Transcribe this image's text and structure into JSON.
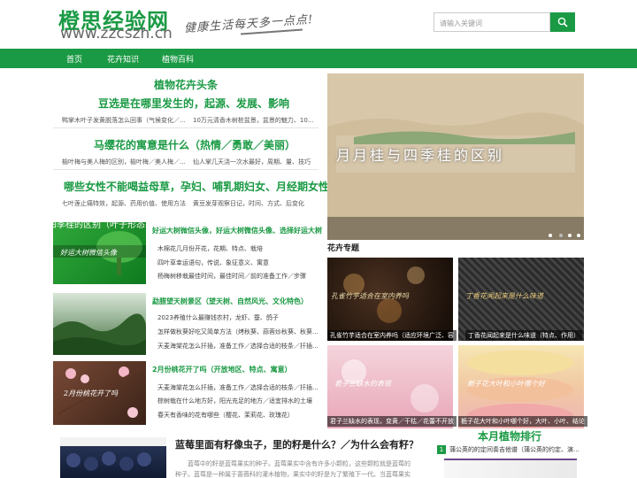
{
  "header": {
    "logo_title": "橙思经验网",
    "logo_url": "www.zzcszh.cn",
    "slogan": "健康生活每天多一点点!",
    "search_placeholder": "请输入关键词"
  },
  "nav": {
    "items": [
      "首页",
      "花卉知识",
      "植物百科"
    ]
  },
  "left": {
    "section_title": "植物花卉头条",
    "headlines": [
      {
        "title": "豆选是在哪里发生的，起源、发展、影响",
        "links": [
          "鸭掌木叶子发黄脱落怎么回事（气候变化／...",
          "10万元清香木树桩盆景，盆景的魅力、10..."
        ]
      },
      {
        "title": "马缨花的寓意是什么（热情／勇敢／美丽）",
        "links": [
          "榆叶梅与美人梅的区别，榆叶梅／美人梅／...",
          "仙人掌几天浇一次水最好，周期、量、技巧"
        ]
      },
      {
        "title": "哪些女性不能喝益母草，孕妇、哺乳期妇女、月经期女性",
        "links": [
          "七叶莲止痛特效，起源、药用价值、使用方法",
          "黄豆发芽观察日记，时间、方式、后变化"
        ]
      }
    ],
    "cards": [
      {
        "img_caption": "好运大树微信头像",
        "title": "好运大树微信头像，好运大树微信头像、选择好运大树",
        "lines": [
          "木棉花几月份开花，花期、特点、栽培",
          "四叶草幸运语句，传说、象征意义、寓意",
          "杨梅树移栽最佳时间，最佳时间／前的准备工作／步骤"
        ]
      },
      {
        "img_caption": "",
        "title": "勐腊望天树景区（望天树、自然风光、文化特色）",
        "lines": [
          "2023养殖什么最赚钱农村，龙虾、蚕、鸽子",
          "怎样做秋葵好吃又简单方法（烤秋葵、蒜蓉炒秋葵、秋葵...",
          "天麦海棠花怎么扦插，准备工作／选择合适的枝条／扦插..."
        ]
      },
      {
        "img_caption": "2月份桃花开了吗",
        "title": "2月份桃花开了吗（开放地区、特点、寓意）",
        "lines": [
          "天麦海棠花怎么扦插，准备工作／选择合适的枝条／扦插...",
          "棕树栽在什么地方好，阳光充足的地方／适宜排水的土壤",
          "春天有香味的花有哪些（樱花、茉莉花、玫瑰花）"
        ]
      }
    ],
    "bottom": {
      "title": "蓝莓里面有籽像虫子，里的籽是什么？／为什么会有籽？",
      "lines": [
        "蓝莓中的籽是蓝莓果实的种子。蓝莓果实中含有许多小颗粒，这些颗粒就是蓝莓的",
        "种子。蓝莓是一种属于蔷薇科的灌木植物，果实中的籽是为了繁殖下一代。当蓝莓果实"
      ]
    }
  },
  "right": {
    "slider_text": "月月桂与四季桂的区别",
    "slider_caption": "月月桂与四季桂的区别（叶子形态、花朵特征、适应气候）",
    "topic_title": "花卉专题",
    "topics": [
      {
        "img_text": "孔雀竹芋适合在室内养吗",
        "caption": "孔雀竹芋适合在室内养吗（适应环境广泛、容"
      },
      {
        "img_text": "丁香花闻起来是什么味道",
        "caption": "丁香花闻起来是什么味道（特点、作用）"
      },
      {
        "img_text": "君子兰缺水的表现",
        "caption": "君子兰缺水的表现，变黄／干枯／花蕾不开放"
      },
      {
        "img_text": "栀子花大叶和小叶哪个好",
        "caption": "栀子花大叶和小叶哪个好，大叶、小叶、结论"
      }
    ],
    "rank_title": "本月植物排行",
    "rank": [
      {
        "num": "1",
        "text": "蒲公英的的定间奏吉他谱（蒲公英的约定、演..."
      }
    ]
  },
  "colors": {
    "brand": "#1a9a44"
  }
}
